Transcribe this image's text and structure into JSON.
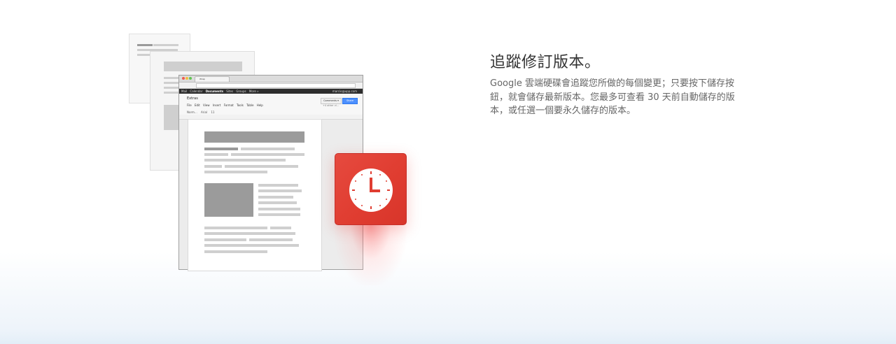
{
  "feature": {
    "title": "追蹤修訂版本。",
    "description": "Google 雲端硬碟會追蹤您所做的每個變更；只要按下儲存按鈕，就會儲存最新版本。您最多可查看 30 天前自動儲存的版本，或任選一個要永久儲存的版本。"
  },
  "illustration": {
    "browser": {
      "tab_title": "Wrap",
      "gbar_links": [
        "Mail",
        "Calendar",
        "Documents",
        "Sites",
        "Groups",
        "More »"
      ],
      "active_link": "Documents",
      "account": "marcio@upp.com",
      "doc_title": "Extras",
      "menu_items": [
        "File",
        "Edit",
        "View",
        "Insert",
        "Format",
        "Tools",
        "Table",
        "Help"
      ],
      "toolbar": [
        "Norm...",
        "Arial",
        "11"
      ],
      "comments_button": "Comments ▾",
      "share_button": "Share",
      "others_label": "+4 other vi..."
    },
    "clock_icon": "clock-icon",
    "colors": {
      "accent_red": "#e03d31",
      "share_blue": "#4d90fe"
    }
  }
}
